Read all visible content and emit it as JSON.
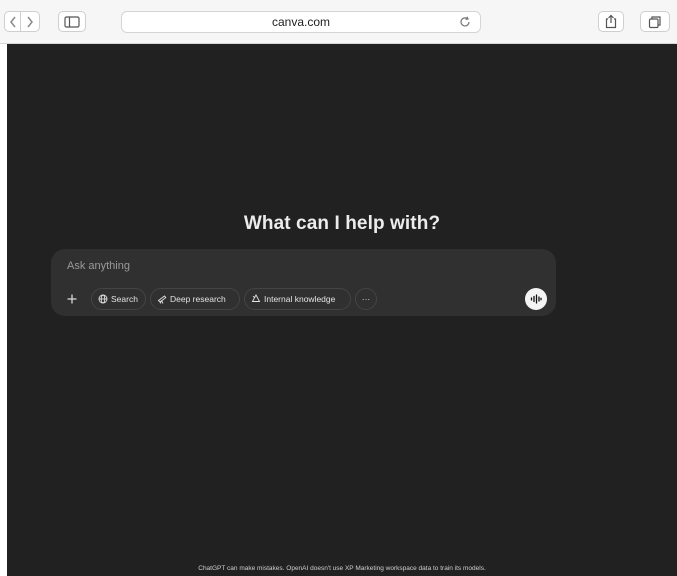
{
  "browser": {
    "url": "canva.com"
  },
  "chat": {
    "headline": "What can I help with?",
    "input_placeholder": "Ask anything",
    "tools": {
      "search_label": "Search",
      "deep_research_label": "Deep research",
      "internal_knowledge_label": "Internal knowledge",
      "more_label": "···"
    },
    "disclaimer": "ChatGPT can make mistakes. OpenAI doesn't use XP Marketing workspace data to train its models."
  },
  "icons": {
    "back": "chevron-left-icon",
    "forward": "chevron-right-icon",
    "sidebar": "sidebar-icon",
    "reload": "reload-icon",
    "share": "share-icon",
    "tabs": "tabs-icon",
    "plus": "plus-icon",
    "search": "globe-icon",
    "deep_research": "telescope-icon",
    "internal_knowledge": "recycle-icon",
    "voice": "voice-waveform-icon"
  },
  "colors": {
    "page_background": "#212121",
    "composer_background": "#303030",
    "headline_text": "#ececec",
    "toolbar_background": "#f6f6f6"
  }
}
